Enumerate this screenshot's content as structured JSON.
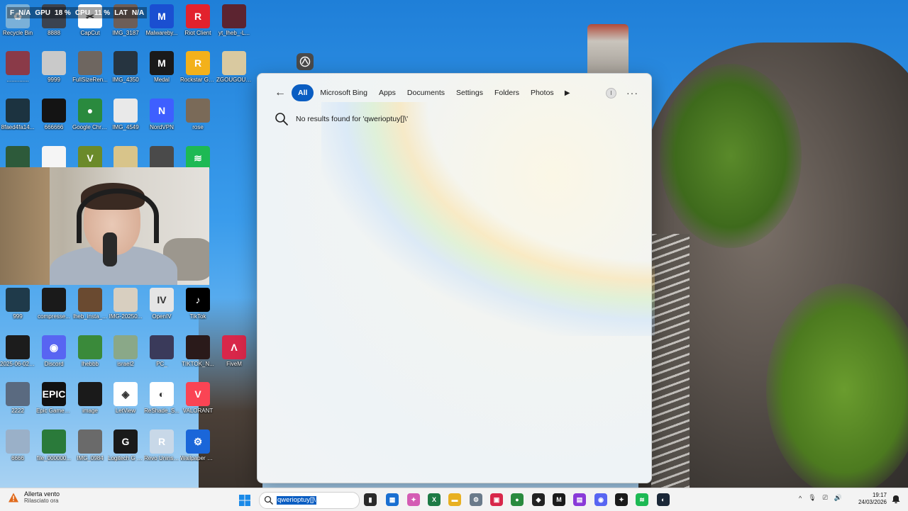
{
  "overlay_stats": [
    {
      "label": "F",
      "value": "N/A"
    },
    {
      "label": "GPU",
      "value": "18 %"
    },
    {
      "label": "CPU",
      "value": "11 %"
    },
    {
      "label": "LAT",
      "value": "N/A"
    }
  ],
  "desktop_icons": [
    {
      "label": "Recycle Bin",
      "color": "#7ab0d8",
      "glyph": "♻"
    },
    {
      "label": "8888",
      "color": "#3b4350",
      "glyph": ""
    },
    {
      "label": "CapCut",
      "color": "#ffffff",
      "glyph": "✂"
    },
    {
      "label": "IMG_3187",
      "color": "#6d5e58",
      "glyph": ""
    },
    {
      "label": "Malwareby...",
      "color": "#1a4fd1",
      "glyph": "M"
    },
    {
      "label": "Riot Client",
      "color": "#e2222d",
      "glyph": "R"
    },
    {
      "label": "yt_lheb_-L...",
      "color": "#5c2430",
      "glyph": ""
    },
    {
      "label": "..............",
      "color": "#8a3a48",
      "glyph": ""
    },
    {
      "label": "9999",
      "color": "#c9c9c9",
      "glyph": ""
    },
    {
      "label": "FullSizeRen...",
      "color": "#6e6660",
      "glyph": ""
    },
    {
      "label": "IMG_4350",
      "color": "#263440",
      "glyph": ""
    },
    {
      "label": "Medal",
      "color": "#1a1a1a",
      "glyph": "M"
    },
    {
      "label": "Rockstar Games ...",
      "color": "#f3b11b",
      "glyph": "R"
    },
    {
      "label": "ZGOUGOUZZ",
      "color": "#d9c9a0",
      "glyph": ""
    },
    {
      "label": "8faed4fa14...",
      "color": "#1c3340",
      "glyph": ""
    },
    {
      "label": "666666",
      "color": "#141414",
      "glyph": ""
    },
    {
      "label": "Google Chrome",
      "color": "#2a8a3e",
      "glyph": "●"
    },
    {
      "label": "IMG_4549",
      "color": "#e9e9e9",
      "glyph": ""
    },
    {
      "label": "NordVPN",
      "color": "#3e5fff",
      "glyph": "N"
    },
    {
      "label": "rose",
      "color": "#7a6a58",
      "glyph": ""
    },
    {
      "label": "",
      "color": "#2d5a3a",
      "glyph": ""
    },
    {
      "label": "",
      "color": "#f5f5f5",
      "glyph": ""
    },
    {
      "label": "",
      "color": "#6b8a2a",
      "glyph": "V"
    },
    {
      "label": "",
      "color": "#d8c48a",
      "glyph": ""
    },
    {
      "label": "",
      "color": "#4a4a4a",
      "glyph": ""
    },
    {
      "label": "",
      "color": "#1db954",
      "glyph": "≋"
    },
    {
      "label": "999",
      "color": "#1f3a4a",
      "glyph": ""
    },
    {
      "label": "compresse...",
      "color": "#1a1a1a",
      "glyph": ""
    },
    {
      "label": "lheb_insta_...",
      "color": "#6a4a30",
      "glyph": ""
    },
    {
      "label": "IMG-20250...",
      "color": "#d8cfc0",
      "glyph": ""
    },
    {
      "label": "OpenIV",
      "color": "#e5e5e5",
      "glyph": "IV"
    },
    {
      "label": "TikTok",
      "color": "#000000",
      "glyph": "♪"
    },
    {
      "label": "2025-06-02 22-07-01",
      "color": "#1c1c1c",
      "glyph": ""
    },
    {
      "label": "Discord",
      "color": "#5865f2",
      "glyph": "◉"
    },
    {
      "label": "lhebbb",
      "color": "#3a8a3a",
      "glyph": ""
    },
    {
      "label": "israel2",
      "color": "#8aa888",
      "glyph": ""
    },
    {
      "label": "PC_",
      "color": "#3a3a5a",
      "glyph": ""
    },
    {
      "label": "TIKTOK_N...",
      "color": "#2a1a1a",
      "glyph": ""
    },
    {
      "label": "FiveM",
      "color": "#d8274a",
      "glyph": "Λ"
    },
    {
      "label": "2222",
      "color": "#5a6a80",
      "glyph": ""
    },
    {
      "label": "Epic Games Launcher",
      "color": "#111111",
      "glyph": "EPIC"
    },
    {
      "label": "image",
      "color": "#1a1a1a",
      "glyph": ""
    },
    {
      "label": "LetView",
      "color": "#ffffff",
      "glyph": "◈"
    },
    {
      "label": "ReShade_S...",
      "color": "#ffffff",
      "glyph": "◐"
    },
    {
      "label": "VALORANT",
      "color": "#fa4454",
      "glyph": "V"
    },
    {
      "label": "6666",
      "color": "#9ab0c8",
      "glyph": ""
    },
    {
      "label": "file_000000...",
      "color": "#2a7a3a",
      "glyph": ""
    },
    {
      "label": "IMG_0984",
      "color": "#6a6a6a",
      "glyph": ""
    },
    {
      "label": "Logitech G HUB",
      "color": "#1a1a1a",
      "glyph": "G"
    },
    {
      "label": "Revo Uninstaller",
      "color": "#c8d8e8",
      "glyph": "R"
    },
    {
      "label": "Wallpaper Engine",
      "color": "#1a66d9",
      "glyph": "⚙"
    }
  ],
  "search_panel": {
    "tabs": [
      {
        "label": "All",
        "active": true
      },
      {
        "label": "Microsoft Bing",
        "active": false
      },
      {
        "label": "Apps",
        "active": false
      },
      {
        "label": "Documents",
        "active": false
      },
      {
        "label": "Settings",
        "active": false
      },
      {
        "label": "Folders",
        "active": false
      },
      {
        "label": "Photos",
        "active": false
      }
    ],
    "more_tabs_glyph": "▶",
    "profile_initial": "I",
    "overflow_glyph": "···",
    "back_glyph": "←",
    "no_results_text": "No results found for 'qwerioptuy[]\\'"
  },
  "taskbar": {
    "weather_title": "Allerta vento",
    "weather_subtitle": "Rilasciato ora",
    "search_value": "qwerioptuy[]\\",
    "clock_time": "19:17",
    "clock_date": "24/03/2026",
    "pinned_apps": [
      {
        "name": "task-view",
        "color": "#2a2a2a",
        "glyph": "▮"
      },
      {
        "name": "app-blue",
        "color": "#1a6fd1",
        "glyph": "▦"
      },
      {
        "name": "excel",
        "color": "#1d7a45",
        "glyph": "X"
      },
      {
        "name": "copilot",
        "color": "#d45cb4",
        "glyph": "✦"
      },
      {
        "name": "file-explorer",
        "color": "#e8b021",
        "glyph": "▬"
      },
      {
        "name": "settings",
        "color": "#6a7a8a",
        "glyph": "⚙"
      },
      {
        "name": "app-red",
        "color": "#d8274a",
        "glyph": "▣"
      },
      {
        "name": "chrome",
        "color": "#2a8a3e",
        "glyph": "●"
      },
      {
        "name": "app-dark",
        "color": "#222222",
        "glyph": "◆"
      },
      {
        "name": "medal",
        "color": "#1a1a1a",
        "glyph": "M"
      },
      {
        "name": "app-purple",
        "color": "#8a3ad8",
        "glyph": "▤"
      },
      {
        "name": "discord",
        "color": "#5865f2",
        "glyph": "◉"
      },
      {
        "name": "app-black",
        "color": "#1a1a1a",
        "glyph": "✦"
      },
      {
        "name": "spotify",
        "color": "#1db954",
        "glyph": "≋"
      },
      {
        "name": "steam",
        "color": "#1b2838",
        "glyph": "◐"
      }
    ],
    "tray_glyphs": [
      "^",
      "🎙",
      "⎚",
      "🔊"
    ]
  }
}
